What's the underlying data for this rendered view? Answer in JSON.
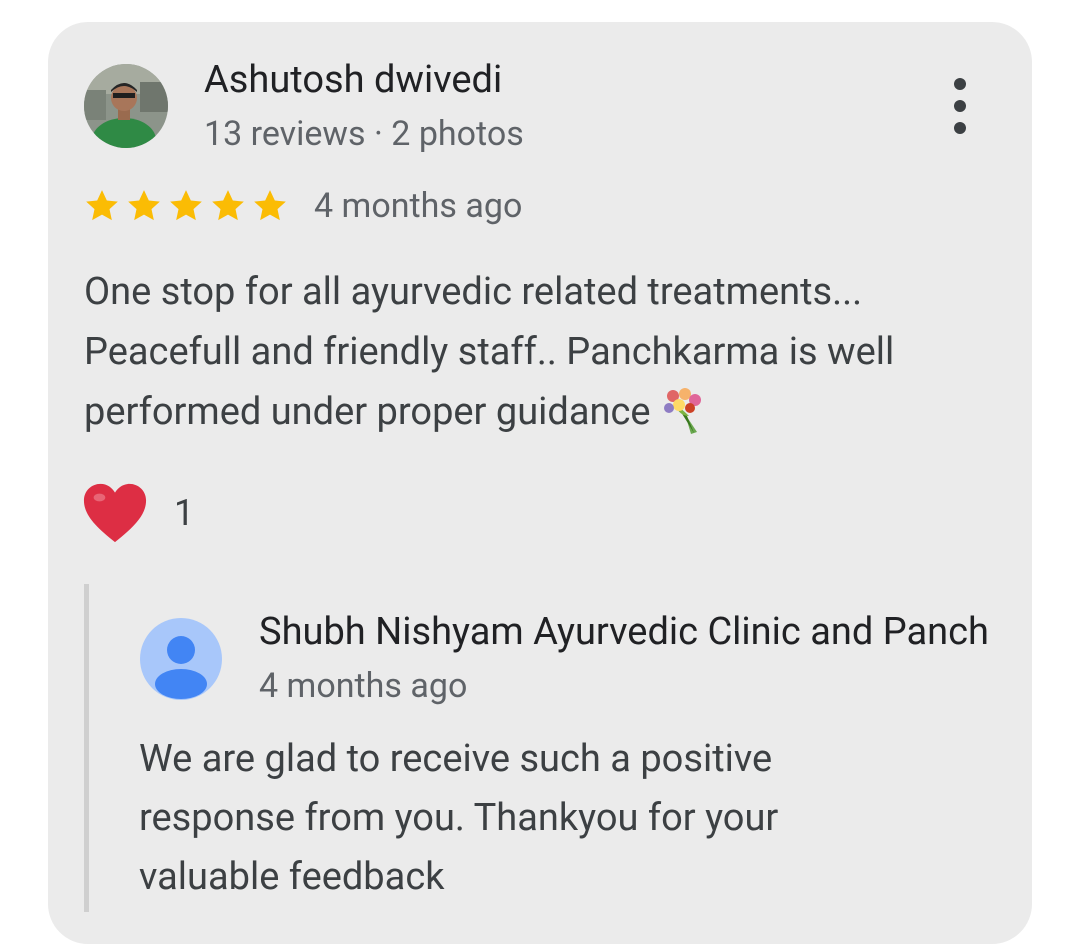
{
  "review": {
    "reviewer_name": "Ashutosh dwivedi",
    "reviewer_meta": "13 reviews · 2 photos",
    "rating": 5,
    "relative_time": "4 months ago",
    "text": "One stop for all ayurvedic related treatments... Peacefull and friendly staff.. Panchkarma is well performed under proper guidance",
    "emoji": "bouquet-emoji",
    "reaction_count": "1"
  },
  "owner_reply": {
    "name": "Shubh Nishyam Ayurvedic Clinic and Panch",
    "relative_time": "4 months ago",
    "text": "We are glad to receive such a positive response from you. Thankyou for your valuable feedback"
  },
  "icons": {
    "more": "more-vert-icon",
    "star": "star-icon",
    "heart": "heart-icon",
    "owner_avatar": "person-icon"
  },
  "colors": {
    "card_bg": "#ebebeb",
    "star": "#fbbc04",
    "heart": "#dd2e44",
    "owner_avatar_bg": "#a8c7fa",
    "owner_avatar_fg": "#4285f4"
  }
}
